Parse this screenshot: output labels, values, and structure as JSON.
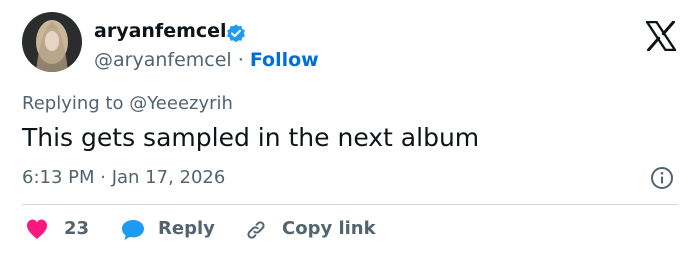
{
  "user": {
    "display_name": "aryanfemcel",
    "handle": "@aryanfemcel",
    "separator": "·",
    "follow_label": "Follow",
    "verified_icon": "verified-badge-icon"
  },
  "reply_context": {
    "text": "Replying to @Yeeezyrih"
  },
  "tweet": {
    "text": "This gets sampled in the next album",
    "timestamp": "6:13 PM · Jan 17, 2026"
  },
  "actions": {
    "like_count": "23",
    "reply_label": "Reply",
    "copy_link_label": "Copy link"
  },
  "icons": {
    "brand": "x-logo-icon",
    "info": "info-icon",
    "like": "heart-icon",
    "reply": "speech-bubble-icon",
    "copy": "link-icon"
  },
  "colors": {
    "accent_blue": "#1d9bf0",
    "follow_blue": "#006fd6",
    "like_pink": "#f91880",
    "secondary_text": "#536471",
    "primary_text": "#0f1419",
    "divider": "#cfd9de"
  }
}
